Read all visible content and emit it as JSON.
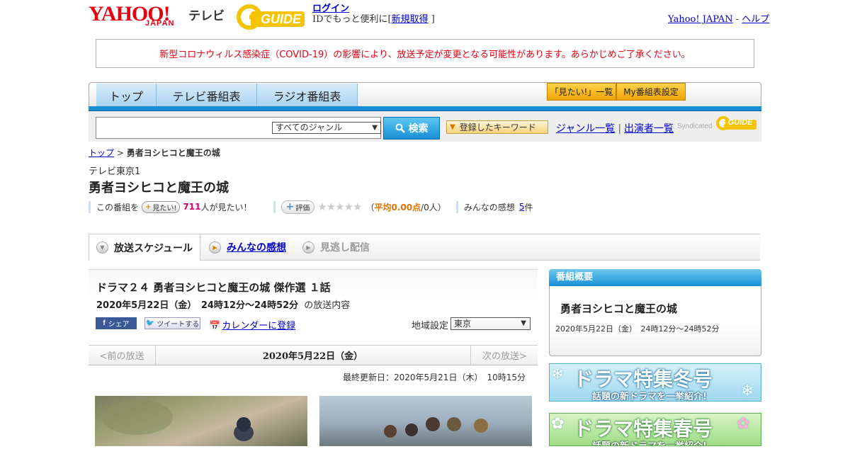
{
  "header": {
    "yahoo_logo": "YAHOO!",
    "japan": "JAPAN",
    "tv": "テレビ",
    "gguide": "GUIDE",
    "login": "ログイン",
    "login_note_prefix": "IDでもっと便利に[",
    "register": "新規取得",
    "login_note_suffix": "]",
    "yahoo_japan_link": "Yahoo! JAPAN",
    "link_sep": " - ",
    "help_link": "ヘルプ"
  },
  "notice": "新型コロナウィルス感染症（COVID-19）の影響により、放送予定が変更となる可能性があります。あらかじめご了承ください。",
  "nav": {
    "tabs": [
      "トップ",
      "テレビ番組表",
      "ラジオ番組表"
    ],
    "mitai_list": "「見たい!」一覧",
    "my_bangumi": "My番組表設定"
  },
  "search": {
    "genre": "すべてのジャンル",
    "button": "検索",
    "keyword_button": "登録したキーワード",
    "genre_list": "ジャンル一覧",
    "performer_list": "出演者一覧",
    "syndicated": "Syndicated",
    "gguide": "G GUIDE"
  },
  "breadcrumb": {
    "top": "トップ",
    "sep": " > ",
    "current": "勇者ヨシヒコと魔王の城"
  },
  "channel": "テレビ東京1",
  "page_title": "勇者ヨシヒコと魔王の城",
  "rating": {
    "prefix": "この番組を",
    "mitai_btn": "見たい!",
    "count": "711",
    "count_suffix": "人が見たい！",
    "hyoka_btn": "評価",
    "stars": "★★★★★",
    "avg_open": "（",
    "avg": "平均0.00点",
    "avg_people": "/0人）",
    "kansou_prefix": "みんなの感想",
    "kansou_count": "5",
    "kansou_suffix": "件"
  },
  "tabs": {
    "schedule": "放送スケジュール",
    "kansou": "みんなの感想",
    "minogashi": "見逃し配信"
  },
  "program": {
    "title": "ドラマ２４ 勇者ヨシヒコと魔王の城 傑作選 １話",
    "time": "2020年5月22日（金）　24時12分～24時52分",
    "time_suffix": "の放送内容",
    "share_fb": "シェア",
    "share_tw": "ツイートする",
    "calendar": "カレンダーに登録",
    "region_label": "地域設定",
    "region": "東京"
  },
  "date_nav": {
    "prev": "<前の放送",
    "current": "2020年5月22日（金）",
    "next": "次の放送>"
  },
  "updated": "最終更新日：2020年5月21日（木）　10時15分",
  "sidebar": {
    "head": "番組概要",
    "title": "勇者ヨシヒコと魔王の城",
    "time": "2020年5月22日（金）　24時12分～24時52分",
    "banner_winter_big": "ドラマ特集冬号",
    "banner_winter_small": "話題の新ドラマを一挙紹介!",
    "banner_spring_big": "ドラマ特集春号",
    "banner_spring_small": "話題の新ドラマを一挙紹介!"
  },
  "colors": {
    "accent": "#1a8fd4",
    "notice": "#e60012",
    "pink": "#d0006f",
    "orange": "#e07000"
  }
}
